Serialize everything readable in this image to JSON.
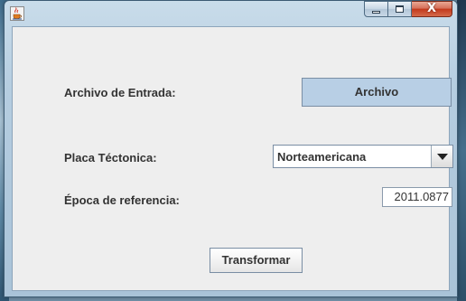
{
  "window": {
    "icon": "java-cup-icon",
    "caption_buttons": {
      "minimize_icon": "minimize-icon",
      "maximize_icon": "maximize-icon",
      "close_label": "X"
    }
  },
  "form": {
    "input_file_label": "Archivo de Entrada:",
    "file_button_label": "Archivo",
    "plate_label": "Placa Téctonica:",
    "plate_selected": "Norteamericana",
    "epoch_label": "Época de referencia:",
    "epoch_value": "2011.0877",
    "transform_button_label": "Transformar"
  },
  "colors": {
    "client_bg": "#eeeeee",
    "file_button_bg": "#b8cfe5",
    "close_button": "#c3391c"
  }
}
